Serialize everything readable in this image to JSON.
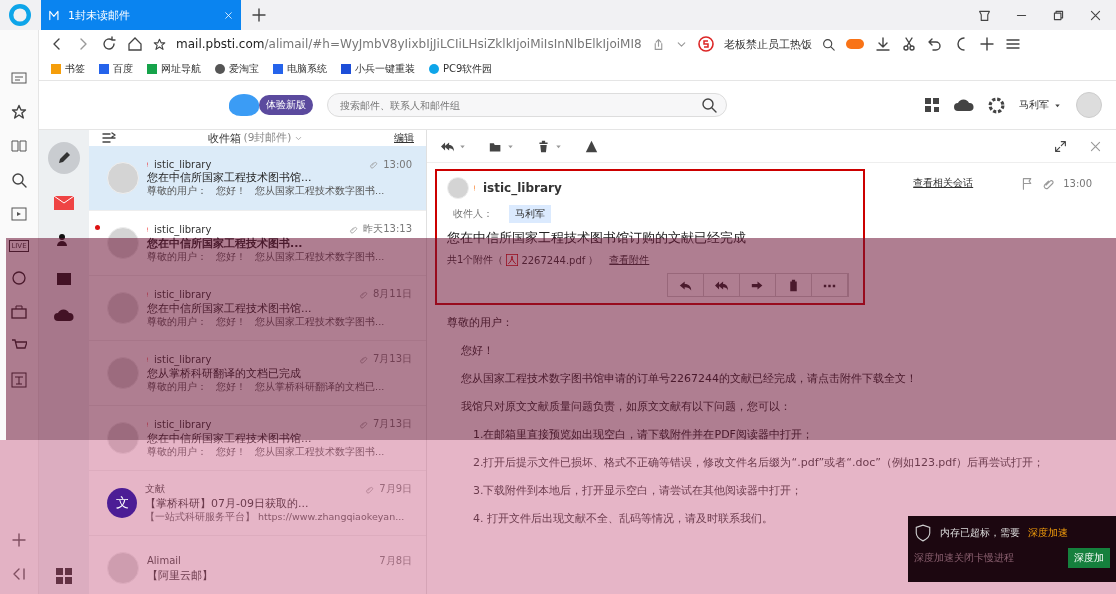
{
  "browser": {
    "tab": {
      "title": "1封未读邮件"
    },
    "url": {
      "domain": "mail.pbsti.com",
      "path": "/alimail/#h=WyJmbV8yIixbIjJiLCIiLHsiZklkIjoiMiIsInNlbElkIjoiMI8"
    },
    "search_engine_text": "老板禁止员工热饭"
  },
  "bookmarks": [
    {
      "label": "书签",
      "kind": "star"
    },
    {
      "label": "百度",
      "kind": "paw"
    },
    {
      "label": "网址导航",
      "kind": "house"
    },
    {
      "label": "爱淘宝",
      "kind": "globe"
    },
    {
      "label": "电脑系统",
      "kind": "swirl"
    },
    {
      "label": "小兵一键重装",
      "kind": "square"
    },
    {
      "label": "PC9软件园",
      "kind": "circle"
    }
  ],
  "sidebar": {
    "live_badge": "LIVE"
  },
  "mail_header": {
    "badge": "体验新版",
    "search_placeholder": "搜索邮件、联系人和邮件组",
    "user": "马利军"
  },
  "folder": {
    "name": "收件箱",
    "count": "(9封邮件)",
    "edit": "编辑"
  },
  "messages": [
    {
      "sender": "istic_library",
      "important": true,
      "time": "13:00",
      "attachment": true,
      "subject": "您在中信所国家工程技术图书馆...",
      "preview": "尊敬的用户：   您好！   您从国家工程技术数字图书...",
      "unread": false,
      "selected": true,
      "kind": "person"
    },
    {
      "sender": "istic_library",
      "important": true,
      "time": "昨天13:13",
      "attachment": true,
      "subject": "您在中信所国家工程技术图书...",
      "preview": "尊敬的用户：   您好！   您从国家工程技术数字图书...",
      "unread": true,
      "selected": false,
      "kind": "person"
    },
    {
      "sender": "istic_library",
      "important": true,
      "time": "8月11日",
      "attachment": true,
      "subject": "您在中信所国家工程技术图书馆...",
      "preview": "尊敬的用户：   您好！   您从国家工程技术数字图书...",
      "unread": false,
      "selected": false,
      "kind": "person"
    },
    {
      "sender": "istic_library",
      "important": true,
      "time": "7月13日",
      "attachment": true,
      "subject": "您从掌桥科研翻译的文档已完成",
      "preview": "尊敬的用户：   您好！   您从掌桥科研翻译的文档已...",
      "unread": false,
      "selected": false,
      "kind": "person"
    },
    {
      "sender": "istic_library",
      "important": true,
      "time": "7月13日",
      "attachment": true,
      "subject": "您在中信所国家工程技术图书馆...",
      "preview": "尊敬的用户：   您好！   您从国家工程技术数字图书...",
      "unread": false,
      "selected": false,
      "kind": "person"
    },
    {
      "sender": "文献",
      "important": false,
      "time": "7月9日",
      "attachment": true,
      "subject": "【掌桥科研】07月-09日获取的...",
      "preview": "【一站式科研服务平台】 https://www.zhangqiaokeyan...",
      "unread": false,
      "selected": false,
      "kind": "letter",
      "letter": "文",
      "color": "#4c1d95"
    },
    {
      "sender": "Alimail",
      "important": false,
      "time": "7月8日",
      "attachment": false,
      "subject": "【阿里云邮】",
      "unread": false,
      "selected": false,
      "kind": "person"
    }
  ],
  "reader": {
    "sender": "istic_library",
    "important": true,
    "related_link": "查看相关会话",
    "time": "13:00",
    "recipient_label": "收件人：",
    "recipient": "马利军",
    "subject": "您在中信所国家工程技术图书馆订购的文献已经完成",
    "attachment_prefix": "共1个附件（",
    "attachment_file": "2267244.pdf",
    "attachment_suffix": "）",
    "view_attachments": "查看附件",
    "body": [
      {
        "text": "尊敬的用户：",
        "kind": "plain"
      },
      {
        "text": "您好！",
        "kind": "indent"
      },
      {
        "text": "您从国家工程技术数字图书馆申请的订单号2267244的文献已经完成，请点击附件下载全文！",
        "kind": "indent"
      },
      {
        "text": "我馆只对原文文献质量问题负责，如原文文献有以下问题，您可以：",
        "kind": "indent"
      },
      {
        "text": "1.在邮箱里直接预览如出现空白，请下载附件并在PDF阅读器中打开；",
        "kind": "list"
      },
      {
        "text": "2.打开后提示文件已损坏、格式不正确等错误，修改文件名后缀为“.pdf”或者“.doc”（例如123.pdf）后再尝试打开；",
        "kind": "list"
      },
      {
        "text": "3.下载附件到本地后，打开显示空白，请尝试在其他阅读器中打开；",
        "kind": "list"
      },
      {
        "text": "4. 打开文件后出现文献不全、乱码等情况，请及时联系我们。",
        "kind": "list"
      }
    ]
  },
  "popup": {
    "message": "内存已超标，需要",
    "action_link": "深度加速",
    "hint": "深度加速关闭卡慢进程",
    "button": "深度加"
  }
}
